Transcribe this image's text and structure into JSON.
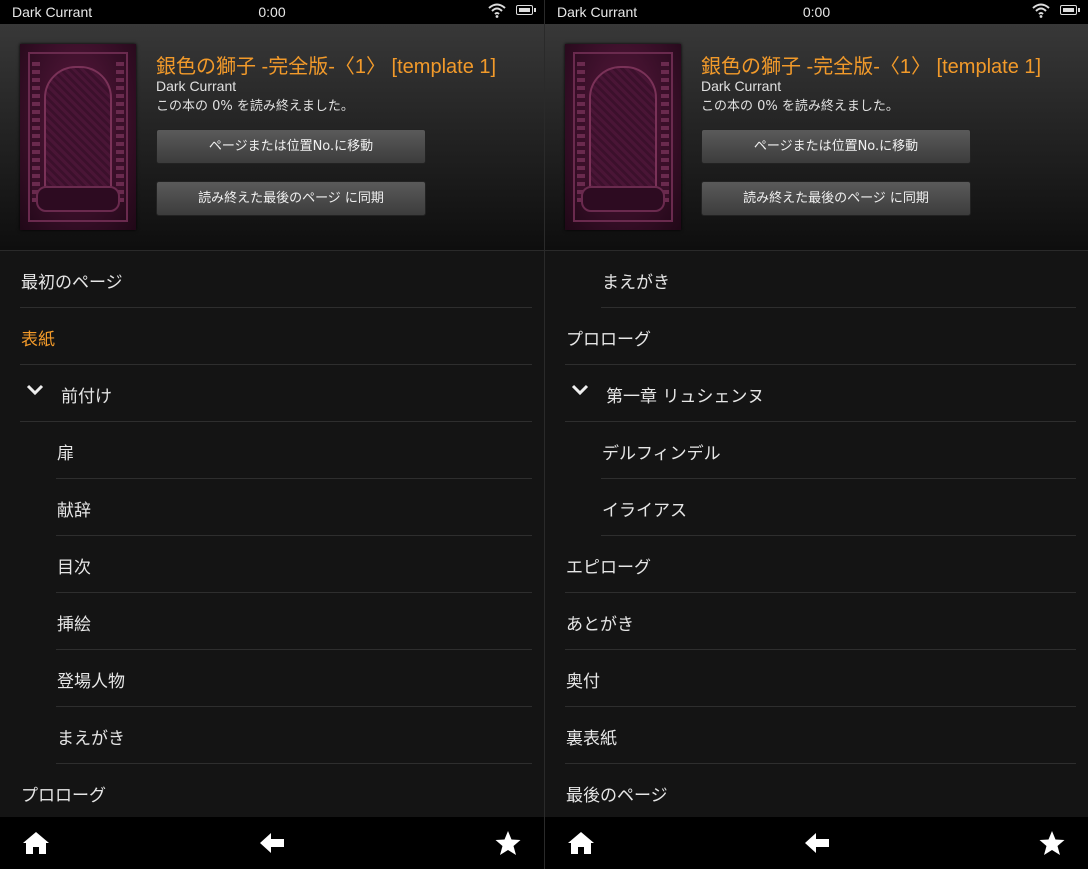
{
  "status_bar": {
    "title": "Dark Currant",
    "time": "0:00"
  },
  "book": {
    "title": "銀色の獅子 -完全版-〈1〉 [template 1]",
    "author": "Dark Currant",
    "progress_text": "この本の 0% を読み終えました。",
    "progress_percent": 0
  },
  "buttons": {
    "goto_label": "ページまたは位置No.に移動",
    "sync_label": "読み終えた最後のページ に同期"
  },
  "left_toc": [
    {
      "label": "最初のページ",
      "level": 0
    },
    {
      "label": "表紙",
      "level": 0,
      "active": true
    },
    {
      "label": "前付け",
      "level": 0,
      "expanded": true
    },
    {
      "label": "扉",
      "level": 1
    },
    {
      "label": "献辞",
      "level": 1
    },
    {
      "label": "目次",
      "level": 1
    },
    {
      "label": "挿絵",
      "level": 1
    },
    {
      "label": "登場人物",
      "level": 1
    },
    {
      "label": "まえがき",
      "level": 1
    },
    {
      "label": "プロローグ",
      "level": 0
    }
  ],
  "right_toc": [
    {
      "label": "まえがき",
      "level": 1
    },
    {
      "label": "プロローグ",
      "level": 0
    },
    {
      "label": "第一章 リュシェンヌ",
      "level": 0,
      "expanded": true
    },
    {
      "label": "デルフィンデル",
      "level": 1
    },
    {
      "label": "イライアス",
      "level": 1
    },
    {
      "label": "エピローグ",
      "level": 0
    },
    {
      "label": "あとがき",
      "level": 0
    },
    {
      "label": "奥付",
      "level": 0
    },
    {
      "label": "裏表紙",
      "level": 0
    },
    {
      "label": "最後のページ",
      "level": 0
    }
  ],
  "bottom_bar": {
    "icons": [
      "home-icon",
      "back-arrow-icon",
      "star-icon"
    ]
  },
  "colors": {
    "accent": "#f29a2a",
    "background": "#141414",
    "text": "#e6e6e6"
  }
}
